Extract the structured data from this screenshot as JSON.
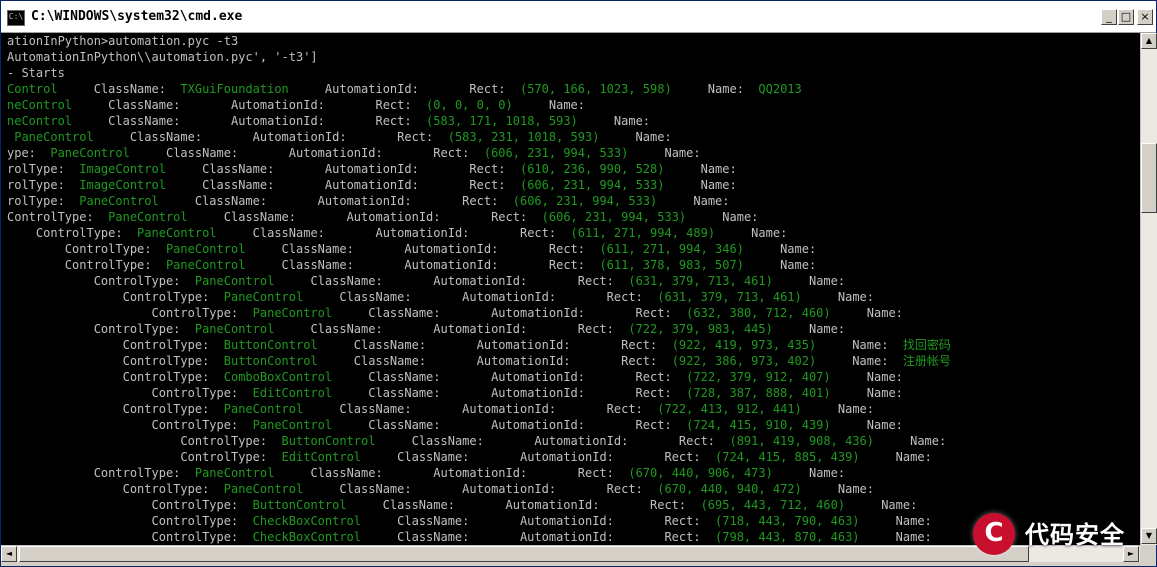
{
  "window": {
    "title": "C:\\WINDOWS\\system32\\cmd.exe",
    "icon_label": "C:\\",
    "controls": {
      "minimize": "_",
      "maximize": "□",
      "close": "×"
    }
  },
  "console": {
    "lines": [
      {
        "segments": [
          {
            "t": "ationInPython>automation.pyc -t3",
            "c": "w"
          }
        ]
      },
      {
        "segments": [
          {
            "t": "AutomationInPython\\\\automation.pyc', '-t3']",
            "c": "w"
          }
        ]
      },
      {
        "segments": [
          {
            "t": "- Starts",
            "c": "w"
          }
        ]
      },
      {
        "segments": [
          {
            "t": "Control",
            "c": "g"
          },
          {
            "t": "     ClassName:  ",
            "c": "w"
          },
          {
            "t": "TXGuiFoundation",
            "c": "g"
          },
          {
            "t": "     AutomationId:       Rect:  ",
            "c": "w"
          },
          {
            "t": "(570, 166, 1023, 598)",
            "c": "g"
          },
          {
            "t": "     Name:  ",
            "c": "w"
          },
          {
            "t": "QQ2013",
            "c": "g"
          }
        ]
      },
      {
        "segments": [
          {
            "t": "neControl",
            "c": "g"
          },
          {
            "t": "     ClassName:       AutomationId:       Rect:  ",
            "c": "w"
          },
          {
            "t": "(0, 0, 0, 0)",
            "c": "g"
          },
          {
            "t": "     Name:",
            "c": "w"
          }
        ]
      },
      {
        "segments": [
          {
            "t": "neControl",
            "c": "g"
          },
          {
            "t": "     ClassName:       AutomationId:       Rect:  ",
            "c": "w"
          },
          {
            "t": "(583, 171, 1018, 593)",
            "c": "g"
          },
          {
            "t": "     Name:",
            "c": "w"
          }
        ]
      },
      {
        "segments": [
          {
            "t": " PaneControl",
            "c": "g"
          },
          {
            "t": "     ClassName:       AutomationId:       Rect:  ",
            "c": "w"
          },
          {
            "t": "(583, 231, 1018, 593)",
            "c": "g"
          },
          {
            "t": "     Name:",
            "c": "w"
          }
        ]
      },
      {
        "segments": [
          {
            "t": "ype:  ",
            "c": "w"
          },
          {
            "t": "PaneControl",
            "c": "g"
          },
          {
            "t": "     ClassName:       AutomationId:       Rect:  ",
            "c": "w"
          },
          {
            "t": "(606, 231, 994, 533)",
            "c": "g"
          },
          {
            "t": "     Name:",
            "c": "w"
          }
        ]
      },
      {
        "segments": [
          {
            "t": "rolType:  ",
            "c": "w"
          },
          {
            "t": "ImageControl",
            "c": "g"
          },
          {
            "t": "     ClassName:       AutomationId:       Rect:  ",
            "c": "w"
          },
          {
            "t": "(610, 236, 990, 528)",
            "c": "g"
          },
          {
            "t": "     Name:",
            "c": "w"
          }
        ]
      },
      {
        "segments": [
          {
            "t": "rolType:  ",
            "c": "w"
          },
          {
            "t": "ImageControl",
            "c": "g"
          },
          {
            "t": "     ClassName:       AutomationId:       Rect:  ",
            "c": "w"
          },
          {
            "t": "(606, 231, 994, 533)",
            "c": "g"
          },
          {
            "t": "     Name:",
            "c": "w"
          }
        ]
      },
      {
        "segments": [
          {
            "t": "rolType:  ",
            "c": "w"
          },
          {
            "t": "PaneControl",
            "c": "g"
          },
          {
            "t": "     ClassName:       AutomationId:       Rect:  ",
            "c": "w"
          },
          {
            "t": "(606, 231, 994, 533)",
            "c": "g"
          },
          {
            "t": "     Name:",
            "c": "w"
          }
        ]
      },
      {
        "segments": [
          {
            "t": "ControlType:  ",
            "c": "w"
          },
          {
            "t": "PaneControl",
            "c": "g"
          },
          {
            "t": "     ClassName:       AutomationId:       Rect:  ",
            "c": "w"
          },
          {
            "t": "(606, 231, 994, 533)",
            "c": "g"
          },
          {
            "t": "     Name:",
            "c": "w"
          }
        ]
      },
      {
        "segments": [
          {
            "t": "    ControlType:  ",
            "c": "w"
          },
          {
            "t": "PaneControl",
            "c": "g"
          },
          {
            "t": "     ClassName:       AutomationId:       Rect:  ",
            "c": "w"
          },
          {
            "t": "(611, 271, 994, 489)",
            "c": "g"
          },
          {
            "t": "     Name:",
            "c": "w"
          }
        ]
      },
      {
        "segments": [
          {
            "t": "        ControlType:  ",
            "c": "w"
          },
          {
            "t": "PaneControl",
            "c": "g"
          },
          {
            "t": "     ClassName:       AutomationId:       Rect:  ",
            "c": "w"
          },
          {
            "t": "(611, 271, 994, 346)",
            "c": "g"
          },
          {
            "t": "     Name:",
            "c": "w"
          }
        ]
      },
      {
        "segments": [
          {
            "t": "        ControlType:  ",
            "c": "w"
          },
          {
            "t": "PaneControl",
            "c": "g"
          },
          {
            "t": "     ClassName:       AutomationId:       Rect:  ",
            "c": "w"
          },
          {
            "t": "(611, 378, 983, 507)",
            "c": "g"
          },
          {
            "t": "     Name:",
            "c": "w"
          }
        ]
      },
      {
        "segments": [
          {
            "t": "            ControlType:  ",
            "c": "w"
          },
          {
            "t": "PaneControl",
            "c": "g"
          },
          {
            "t": "     ClassName:       AutomationId:       Rect:  ",
            "c": "w"
          },
          {
            "t": "(631, 379, 713, 461)",
            "c": "g"
          },
          {
            "t": "     Name:",
            "c": "w"
          }
        ]
      },
      {
        "segments": [
          {
            "t": "                ControlType:  ",
            "c": "w"
          },
          {
            "t": "PaneControl",
            "c": "g"
          },
          {
            "t": "     ClassName:       AutomationId:       Rect:  ",
            "c": "w"
          },
          {
            "t": "(631, 379, 713, 461)",
            "c": "g"
          },
          {
            "t": "     Name:",
            "c": "w"
          }
        ]
      },
      {
        "segments": [
          {
            "t": "                    ControlType:  ",
            "c": "w"
          },
          {
            "t": "PaneControl",
            "c": "g"
          },
          {
            "t": "     ClassName:       AutomationId:       Rect:  ",
            "c": "w"
          },
          {
            "t": "(632, 380, 712, 460)",
            "c": "g"
          },
          {
            "t": "     Name:",
            "c": "w"
          }
        ]
      },
      {
        "segments": [
          {
            "t": "            ControlType:  ",
            "c": "w"
          },
          {
            "t": "PaneControl",
            "c": "g"
          },
          {
            "t": "     ClassName:       AutomationId:       Rect:  ",
            "c": "w"
          },
          {
            "t": "(722, 379, 983, 445)",
            "c": "g"
          },
          {
            "t": "     Name:",
            "c": "w"
          }
        ]
      },
      {
        "segments": [
          {
            "t": "                ControlType:  ",
            "c": "w"
          },
          {
            "t": "ButtonControl",
            "c": "g"
          },
          {
            "t": "     ClassName:       AutomationId:       Rect:  ",
            "c": "w"
          },
          {
            "t": "(922, 419, 973, 435)",
            "c": "g"
          },
          {
            "t": "     Name:  ",
            "c": "w"
          },
          {
            "t": "找回密码",
            "c": "g"
          }
        ]
      },
      {
        "segments": [
          {
            "t": "                ControlType:  ",
            "c": "w"
          },
          {
            "t": "ButtonControl",
            "c": "g"
          },
          {
            "t": "     ClassName:       AutomationId:       Rect:  ",
            "c": "w"
          },
          {
            "t": "(922, 386, 973, 402)",
            "c": "g"
          },
          {
            "t": "     Name:  ",
            "c": "w"
          },
          {
            "t": "注册帐号",
            "c": "g"
          }
        ]
      },
      {
        "segments": [
          {
            "t": "                ControlType:  ",
            "c": "w"
          },
          {
            "t": "ComboBoxControl",
            "c": "g"
          },
          {
            "t": "     ClassName:       AutomationId:       Rect:  ",
            "c": "w"
          },
          {
            "t": "(722, 379, 912, 407)",
            "c": "g"
          },
          {
            "t": "     Name:",
            "c": "w"
          }
        ]
      },
      {
        "segments": [
          {
            "t": "                    ControlType:  ",
            "c": "w"
          },
          {
            "t": "EditControl",
            "c": "g"
          },
          {
            "t": "     ClassName:       AutomationId:       Rect:  ",
            "c": "w"
          },
          {
            "t": "(728, 387, 888, 401)",
            "c": "g"
          },
          {
            "t": "     Name:",
            "c": "w"
          }
        ]
      },
      {
        "segments": [
          {
            "t": "                ControlType:  ",
            "c": "w"
          },
          {
            "t": "PaneControl",
            "c": "g"
          },
          {
            "t": "     ClassName:       AutomationId:       Rect:  ",
            "c": "w"
          },
          {
            "t": "(722, 413, 912, 441)",
            "c": "g"
          },
          {
            "t": "     Name:",
            "c": "w"
          }
        ]
      },
      {
        "segments": [
          {
            "t": "                    ControlType:  ",
            "c": "w"
          },
          {
            "t": "PaneControl",
            "c": "g"
          },
          {
            "t": "     ClassName:       AutomationId:       Rect:  ",
            "c": "w"
          },
          {
            "t": "(724, 415, 910, 439)",
            "c": "g"
          },
          {
            "t": "     Name:",
            "c": "w"
          }
        ]
      },
      {
        "segments": [
          {
            "t": "                        ControlType:  ",
            "c": "w"
          },
          {
            "t": "ButtonControl",
            "c": "g"
          },
          {
            "t": "     ClassName:       AutomationId:       Rect:  ",
            "c": "w"
          },
          {
            "t": "(891, 419, 908, 436)",
            "c": "g"
          },
          {
            "t": "     Name:",
            "c": "w"
          }
        ]
      },
      {
        "segments": [
          {
            "t": "                        ControlType:  ",
            "c": "w"
          },
          {
            "t": "EditControl",
            "c": "g"
          },
          {
            "t": "     ClassName:       AutomationId:       Rect:  ",
            "c": "w"
          },
          {
            "t": "(724, 415, 885, 439)",
            "c": "g"
          },
          {
            "t": "     Name:",
            "c": "w"
          }
        ]
      },
      {
        "segments": [
          {
            "t": "            ControlType:  ",
            "c": "w"
          },
          {
            "t": "PaneControl",
            "c": "g"
          },
          {
            "t": "     ClassName:       AutomationId:       Rect:  ",
            "c": "w"
          },
          {
            "t": "(670, 440, 906, 473)",
            "c": "g"
          },
          {
            "t": "     Name:",
            "c": "w"
          }
        ]
      },
      {
        "segments": [
          {
            "t": "                ControlType:  ",
            "c": "w"
          },
          {
            "t": "PaneControl",
            "c": "g"
          },
          {
            "t": "     ClassName:       AutomationId:       Rect:  ",
            "c": "w"
          },
          {
            "t": "(670, 440, 940, 472)",
            "c": "g"
          },
          {
            "t": "     Name:",
            "c": "w"
          }
        ]
      },
      {
        "segments": [
          {
            "t": "                    ControlType:  ",
            "c": "w"
          },
          {
            "t": "ButtonControl",
            "c": "g"
          },
          {
            "t": "     ClassName:       AutomationId:       Rect:  ",
            "c": "w"
          },
          {
            "t": "(695, 443, 712, 460)",
            "c": "g"
          },
          {
            "t": "     Name:",
            "c": "w"
          }
        ]
      },
      {
        "segments": [
          {
            "t": "                    ControlType:  ",
            "c": "w"
          },
          {
            "t": "CheckBoxControl",
            "c": "g"
          },
          {
            "t": "     ClassName:       AutomationId:       Rect:  ",
            "c": "w"
          },
          {
            "t": "(718, 443, 790, 463)",
            "c": "g"
          },
          {
            "t": "     Name:",
            "c": "w"
          }
        ]
      },
      {
        "segments": [
          {
            "t": "                    ControlType:  ",
            "c": "w"
          },
          {
            "t": "CheckBoxControl",
            "c": "g"
          },
          {
            "t": "     ClassName:       AutomationId:       Rect:  ",
            "c": "w"
          },
          {
            "t": "(798, 443, 870, 463)",
            "c": "g"
          },
          {
            "t": "     Name:",
            "c": "w"
          }
        ]
      }
    ]
  },
  "scrollbar": {
    "up": "▲",
    "down": "▼",
    "left": "◄",
    "right": "►"
  },
  "watermark": {
    "logo_letter": "C",
    "text": "代码安全"
  },
  "colors": {
    "console_bg": "#000000",
    "console_text": "#c0c0c0",
    "highlight_text": "#1f9a1f"
  }
}
